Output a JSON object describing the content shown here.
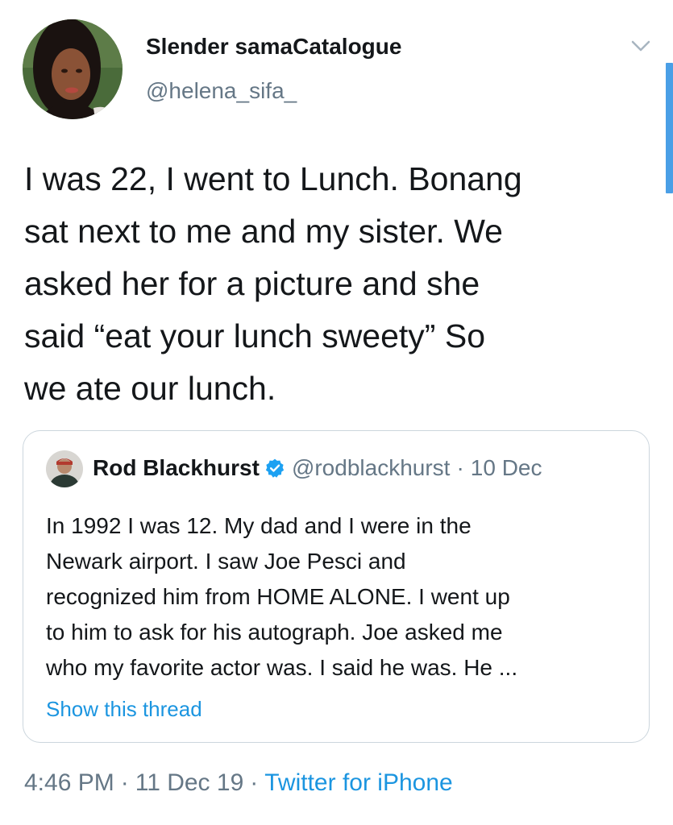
{
  "tweet": {
    "author": {
      "display_name": "Slender samaCatalogue",
      "handle": "@helena_sifa_",
      "avatar_icon": "profile-photo"
    },
    "menu_icon": "chevron-down-icon",
    "text": "I was 22, I went to Lunch. Bonang\nsat next to me and my sister. We\nasked her for a picture and she\nsaid “eat your lunch sweety” So\nwe ate our lunch.",
    "quote": {
      "author": {
        "display_name": "Rod Blackhurst",
        "handle": "@rodblackhurst",
        "verified": true,
        "avatar_icon": "profile-photo"
      },
      "separator": "·",
      "date": "10 Dec",
      "text": "In 1992 I was 12. My dad and I were in the\nNewark airport. I saw Joe Pesci and\nrecognized him from HOME ALONE. I went up\nto him to ask for his autograph. Joe asked me\nwho my favorite actor was. I said he was. He ...",
      "show_thread_label": "Show this thread"
    },
    "meta": {
      "time": "4:46 PM",
      "separator": "·",
      "date": "11 Dec 19",
      "source": "Twitter for iPhone"
    }
  },
  "colors": {
    "text_primary": "#14171a",
    "text_secondary": "#657786",
    "link": "#1b95e0",
    "border": "#ccd6dd",
    "verified_badge": "#1da1f2"
  }
}
